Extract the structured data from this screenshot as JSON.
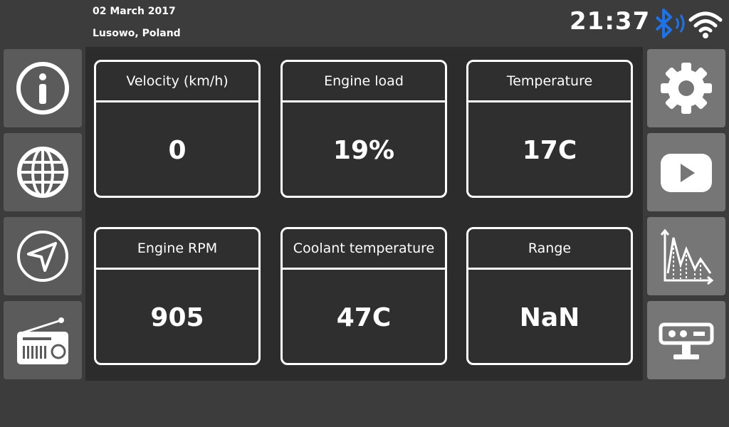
{
  "status": {
    "date": "02 March 2017",
    "location": "Lusowo, Poland",
    "time": "21:37",
    "icons": [
      "bluetooth-icon",
      "wifi-icon"
    ],
    "bluetooth_color": "#1e73e8"
  },
  "left_nav": [
    "info-icon",
    "globe-icon",
    "navigation-icon",
    "radio-icon"
  ],
  "right_nav": [
    "settings-icon",
    "video-icon",
    "chart-icon",
    "camera-icon"
  ],
  "tiles": [
    {
      "label": "Velocity (km/h)",
      "value": "0"
    },
    {
      "label": "Engine load",
      "value": "19%"
    },
    {
      "label": "Temperature",
      "value": "17C"
    },
    {
      "label": "Engine RPM",
      "value": "905"
    },
    {
      "label": "Coolant temperature",
      "value": "47C"
    },
    {
      "label": "Range",
      "value": "NaN"
    }
  ]
}
